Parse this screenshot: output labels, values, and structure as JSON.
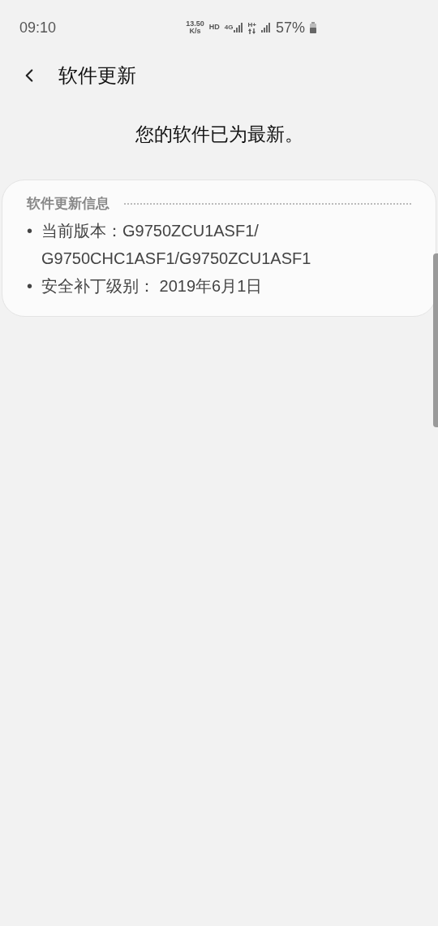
{
  "status_bar": {
    "time": "09:10",
    "speed": "13.50",
    "speed_unit": "K/s",
    "hd": "HD",
    "network": "4G",
    "data": "H+",
    "battery": "57%"
  },
  "header": {
    "title": "软件更新"
  },
  "message": "您的软件已为最新。",
  "info_card": {
    "title": "软件更新信息",
    "items": [
      {
        "bullet": "•",
        "lines": [
          "当前版本：G9750ZCU1ASF1/",
          "G9750CHC1ASF1/G9750ZCU1ASF1"
        ]
      },
      {
        "bullet": "•",
        "lines": [
          "安全补丁级别： 2019年6月1日"
        ]
      }
    ]
  }
}
